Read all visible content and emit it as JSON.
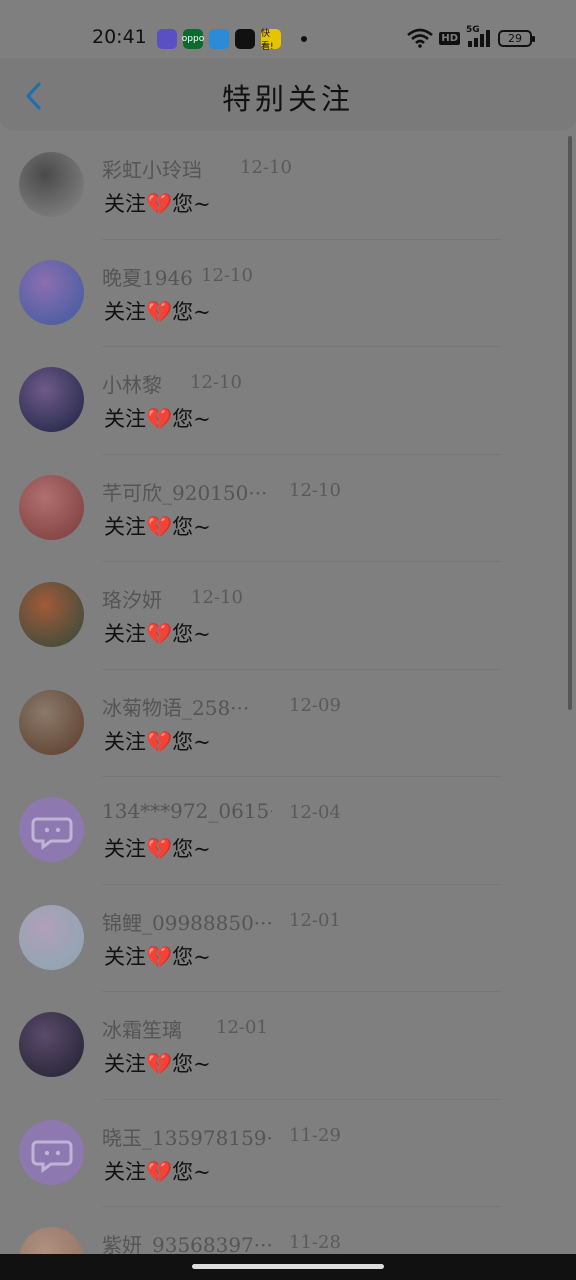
{
  "status": {
    "time": "20:41",
    "network": "5G",
    "hd": "HD",
    "battery": "29",
    "apps": [
      {
        "icon": "assistant-app-icon",
        "label": "",
        "color": "#5a4fc5"
      },
      {
        "icon": "oppo-app-icon",
        "label": "oppo",
        "color": "#0b6b2f"
      },
      {
        "icon": "telegram-app-icon",
        "label": "",
        "color": "#2a8bd6"
      },
      {
        "icon": "video-app-icon",
        "label": "",
        "color": "#111111"
      },
      {
        "icon": "kuaigou-app-icon",
        "label": "快看!",
        "color": "#e6c400"
      }
    ]
  },
  "header": {
    "title": "特别关注",
    "back_icon": "chevron-left-icon",
    "accent": "#1f6fb0"
  },
  "items": [
    {
      "name": "彩虹小玲珰",
      "date": "12-10",
      "message": "关注💔您~",
      "avatar": {
        "kind": "photo",
        "c1": "#8a8a8a",
        "c2": "#4a4a4a"
      }
    },
    {
      "name": "晚夏1946",
      "date": "12-10",
      "message": "关注💔您~",
      "avatar": {
        "kind": "photo",
        "c1": "#3d5aa0",
        "c2": "#8b6fb0"
      }
    },
    {
      "name": "小林黎",
      "date": "12-10",
      "message": "关注💔您~",
      "avatar": {
        "kind": "photo",
        "c1": "#1b2240",
        "c2": "#6e5a8a"
      }
    },
    {
      "name": "芊可欣_920150···",
      "date": "12-10",
      "message": "关注💔您~",
      "avatar": {
        "kind": "photo",
        "c1": "#7a3a3a",
        "c2": "#b07070"
      }
    },
    {
      "name": "珞汐妍",
      "date": "12-10",
      "message": "关注💔您~",
      "avatar": {
        "kind": "photo",
        "c1": "#2f4a3a",
        "c2": "#a05a3a"
      }
    },
    {
      "name": "冰菊物语_258···",
      "date": "12-09",
      "message": "关注💔您~",
      "avatar": {
        "kind": "photo",
        "c1": "#5a3a2a",
        "c2": "#8a7a6a"
      }
    },
    {
      "name": "134***972_0615···",
      "date": "12-04",
      "message": "关注💔您~",
      "avatar": {
        "kind": "default",
        "c1": "#8e78b0",
        "c2": "#8e78b0"
      }
    },
    {
      "name": "锦鲤_09988850···",
      "date": "12-01",
      "message": "关注💔您~",
      "avatar": {
        "kind": "photo",
        "c1": "#8aa6b0",
        "c2": "#b0a0b8"
      }
    },
    {
      "name": "冰霜笙璃",
      "date": "12-01",
      "message": "关注💔您~",
      "avatar": {
        "kind": "photo",
        "c1": "#1f2030",
        "c2": "#5a4a6a"
      }
    },
    {
      "name": "晓玉_135978159···",
      "date": "11-29",
      "message": "关注💔您~",
      "avatar": {
        "kind": "default",
        "c1": "#8e78b0",
        "c2": "#8e78b0"
      }
    },
    {
      "name": "紫妍_93568397···",
      "date": "11-28",
      "message": "关注💔您~",
      "avatar": {
        "kind": "photo",
        "c1": "#8a7060",
        "c2": "#b09080"
      }
    }
  ]
}
